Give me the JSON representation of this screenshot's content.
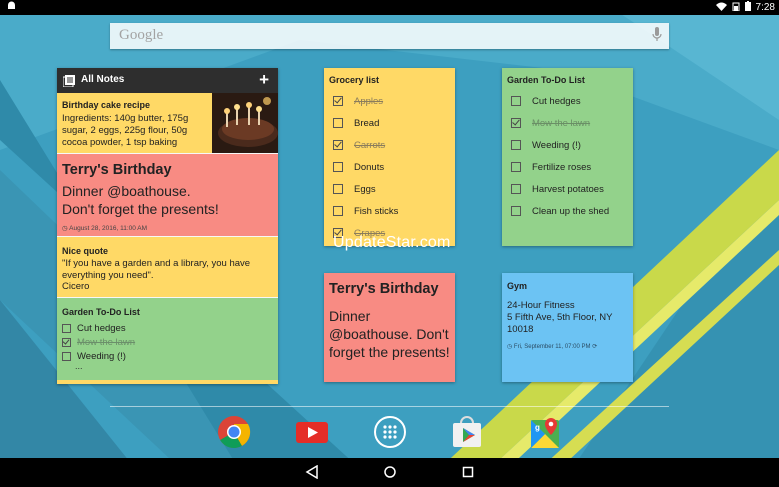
{
  "status_bar": {
    "time": "7:28",
    "left_icon": "android-notification-icon",
    "icons": [
      "wifi-icon",
      "signal-icon",
      "battery-icon"
    ]
  },
  "search": {
    "logo": "Google",
    "mic_icon": "mic-icon"
  },
  "all_notes": {
    "title": "All Notes",
    "add_label": "+",
    "notes": {
      "cake": {
        "title": "Birthday cake recipe",
        "body": "Ingredients: 140g butter, 175g sugar, 2 eggs, 225g flour, 50g cocoa powder, 1 tsp baking"
      },
      "terry": {
        "title": "Terry's Birthday",
        "line1": "Dinner @boathouse.",
        "line2": "Don't forget the presents!",
        "date": "August 28, 2016, 11:00 AM"
      },
      "quote": {
        "title": "Nice quote",
        "body": "\"If you have a garden and a library, you have everything you need\".",
        "author": "Cicero"
      },
      "garden": {
        "title": "Garden To-Do List",
        "items": [
          {
            "label": "Cut hedges",
            "done": false
          },
          {
            "label": "Mow the lawn",
            "done": true
          },
          {
            "label": "Weeding (!)",
            "done": false
          }
        ],
        "more": "..."
      }
    }
  },
  "grocery": {
    "title": "Grocery list",
    "items": [
      {
        "label": "Apples",
        "done": true
      },
      {
        "label": "Bread",
        "done": false
      },
      {
        "label": "Carrots",
        "done": true
      },
      {
        "label": "Donuts",
        "done": false
      },
      {
        "label": "Eggs",
        "done": false
      },
      {
        "label": "Fish sticks",
        "done": false
      },
      {
        "label": "Grapes",
        "done": true
      }
    ]
  },
  "garden": {
    "title": "Garden To-Do List",
    "items": [
      {
        "label": "Cut hedges",
        "done": false
      },
      {
        "label": "Mow the lawn",
        "done": true
      },
      {
        "label": "Weeding (!)",
        "done": false
      },
      {
        "label": "Fertilize roses",
        "done": false
      },
      {
        "label": "Harvest potatoes",
        "done": false
      },
      {
        "label": "Clean up the shed",
        "done": false
      }
    ]
  },
  "terry_big": {
    "title": "Terry's Birthday",
    "body": "Dinner @boathouse. Don't forget the presents!"
  },
  "gym": {
    "title": "Gym",
    "line1": "24-Hour Fitness",
    "line2": "5 Fifth Ave, 5th Floor, NY 10018",
    "date": "Fri, September 11, 07:00 PM"
  },
  "watermark": "UpdateStar.com",
  "dock": [
    "chrome-icon",
    "youtube-icon",
    "app-drawer-icon",
    "play-store-icon",
    "maps-icon"
  ],
  "nav": [
    "back-icon",
    "home-icon",
    "recents-icon"
  ],
  "colors": {
    "yellow_note": "#ffd966",
    "green_note": "#93d28b",
    "red_note": "#f88b83",
    "blue_note": "#6cc3f3",
    "wallpaper": "#3fa0c0"
  }
}
